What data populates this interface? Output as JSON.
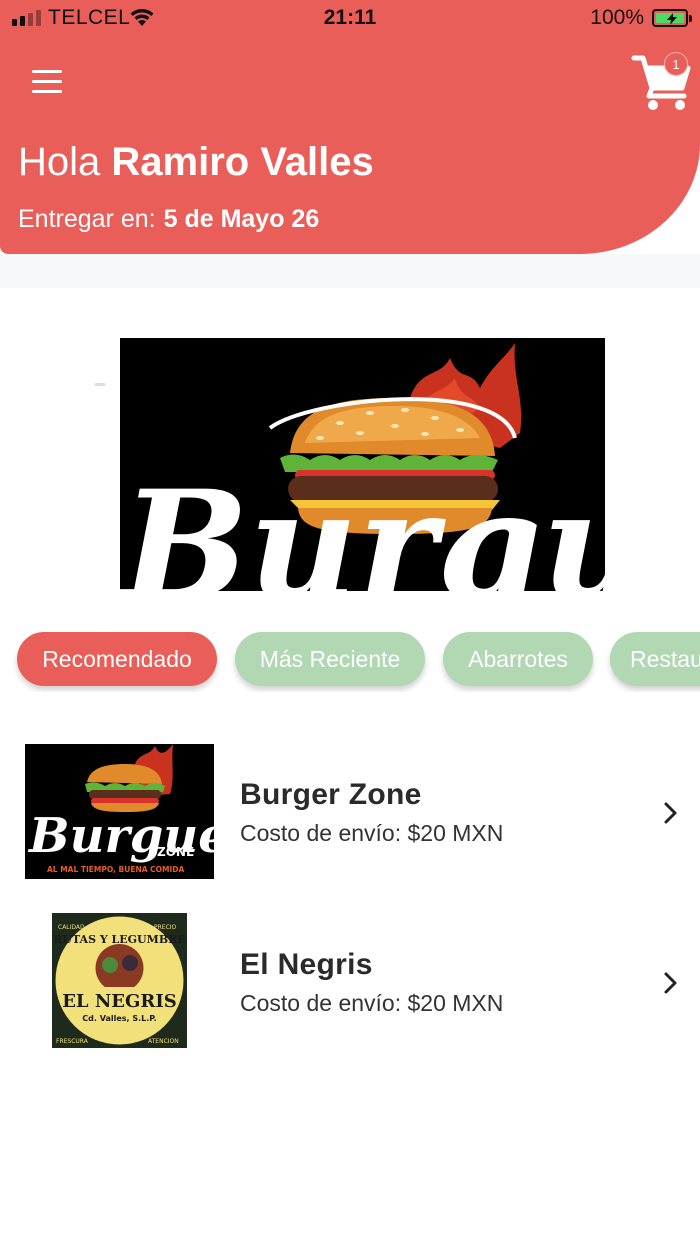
{
  "status_bar": {
    "carrier": "TELCEL",
    "time": "21:11",
    "battery_percent": "100%",
    "battery_level": 1.0,
    "signal_bars_active": 2,
    "signal_bars_total": 4
  },
  "header": {
    "greeting_prefix": "Hola",
    "user_name": "Ramiro Valles",
    "deliver_label": "Entregar en:",
    "deliver_address": "5 de Mayo 26",
    "cart_count": "1",
    "background_color": "#e95e59"
  },
  "banner": {
    "brand_text": "Burguer"
  },
  "categories": [
    {
      "label": "Recomendado",
      "selected": true
    },
    {
      "label": "Más Reciente",
      "selected": false
    },
    {
      "label": "Abarrotes",
      "selected": false
    },
    {
      "label": "Restaurantes",
      "selected": false
    }
  ],
  "stores": [
    {
      "name": "Burger Zone",
      "shipping": "Costo de envío: $20 MXN",
      "logo": {
        "brand": "Burguer",
        "sub": "ZONE",
        "tagline": "AL MAL TIEMPO, BUENA COMIDA"
      }
    },
    {
      "name": "El Negris",
      "shipping": "Costo de envío: $20 MXN",
      "logo": {
        "top": "FRUTAS Y LEGUMBRES",
        "main": "EL NEGRIS",
        "place": "Cd. Valles, S.L.P.",
        "left": "CALIDAD",
        "right": "PRECIO",
        "bottom_left": "FRESCURA",
        "bottom_right": "ATENCION"
      }
    }
  ],
  "colors": {
    "accent": "#e95e59",
    "chip_inactive": "#b1d7b3",
    "battery_green": "#4cd964"
  },
  "icons": {
    "menu": "hamburger-menu-icon",
    "cart": "shopping-cart-icon",
    "chevron": "chevron-right-icon",
    "wifi": "wifi-icon",
    "signal": "cellular-signal-icon",
    "battery": "battery-charging-icon"
  }
}
